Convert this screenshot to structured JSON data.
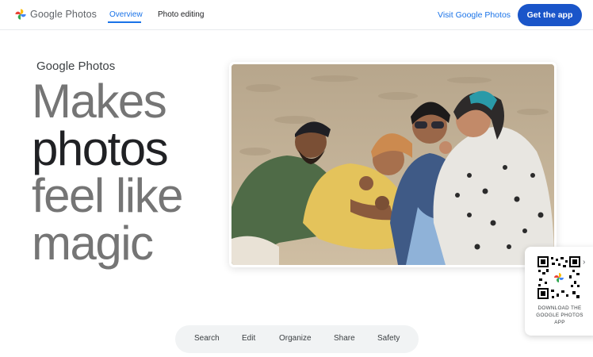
{
  "topbar": {
    "brand": "Google Photos",
    "tabs": [
      "Overview",
      "Photo editing"
    ],
    "active_tab": "Overview",
    "visit_link": "Visit Google Photos",
    "get_app": "Get the app"
  },
  "hero": {
    "brand": "Google Photos",
    "headline": [
      "Makes",
      "photos",
      "feel like",
      "magic"
    ]
  },
  "qr": {
    "caption": "DOWNLOAD THE GOOGLE PHOTOS APP",
    "chevron": "›"
  },
  "section_nav": [
    "Search",
    "Edit",
    "Organize",
    "Share",
    "Safety"
  ],
  "colors": {
    "accent": "#1a73e8",
    "button": "#1a55c9",
    "headline_grey": "#757575",
    "headline_dark": "#202124"
  },
  "icons": [
    "google-photos-pinwheel-icon",
    "qr-code-icon",
    "chevron-right-icon"
  ]
}
